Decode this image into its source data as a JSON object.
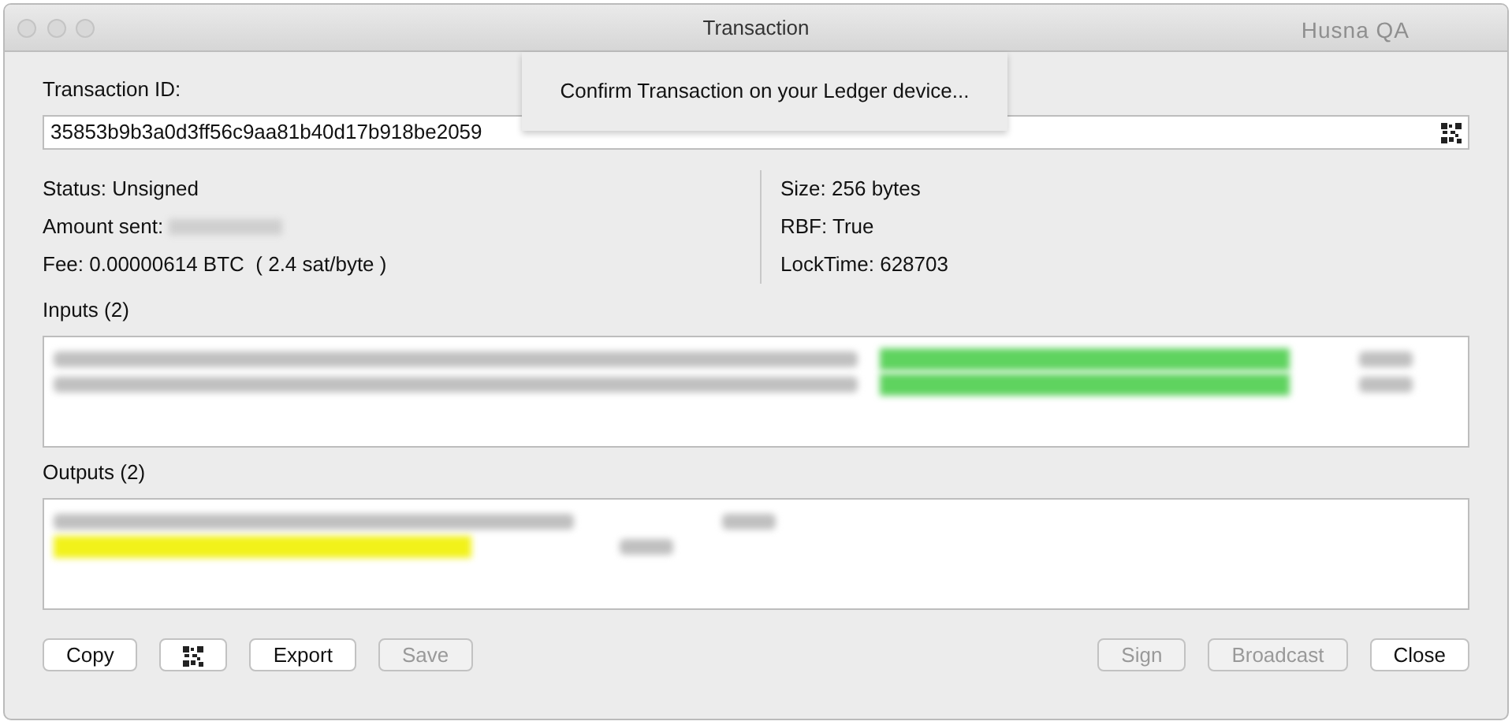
{
  "window": {
    "title": "Transaction",
    "user": "Husna QA"
  },
  "overlay": {
    "message": "Confirm Transaction on your Ledger device..."
  },
  "txid": {
    "label": "Transaction ID:",
    "value": "35853b9b3a0d3ff56c9aa81b40d17b918be2059"
  },
  "details_left": [
    {
      "text": "Status: Unsigned",
      "redacted": false
    },
    {
      "text": "Amount sent:",
      "redacted": true
    },
    {
      "text": "Fee: 0.00000614 BTC  ( 2.4 sat/byte )",
      "redacted": false
    }
  ],
  "details_right": [
    {
      "text": "Size: 256 bytes"
    },
    {
      "text": "RBF: True"
    },
    {
      "text": "LockTime: 628703"
    }
  ],
  "inputs": {
    "label": "Inputs (2)",
    "rows": [
      {
        "color": "#5fd35f"
      },
      {
        "color": "#5fd35f"
      }
    ]
  },
  "outputs": {
    "label": "Outputs (2)",
    "rows": [
      {
        "color": null
      },
      {
        "color": "#f2f21a"
      }
    ]
  },
  "buttons_left": [
    {
      "label": "Copy",
      "kind": "text",
      "disabled": false
    },
    {
      "kind": "qr",
      "disabled": false
    },
    {
      "label": "Export",
      "kind": "text",
      "disabled": false
    },
    {
      "label": "Save",
      "kind": "text",
      "disabled": true
    }
  ],
  "buttons_right": [
    {
      "label": "Sign",
      "disabled": true
    },
    {
      "label": "Broadcast",
      "disabled": true
    },
    {
      "label": "Close",
      "disabled": false
    }
  ]
}
